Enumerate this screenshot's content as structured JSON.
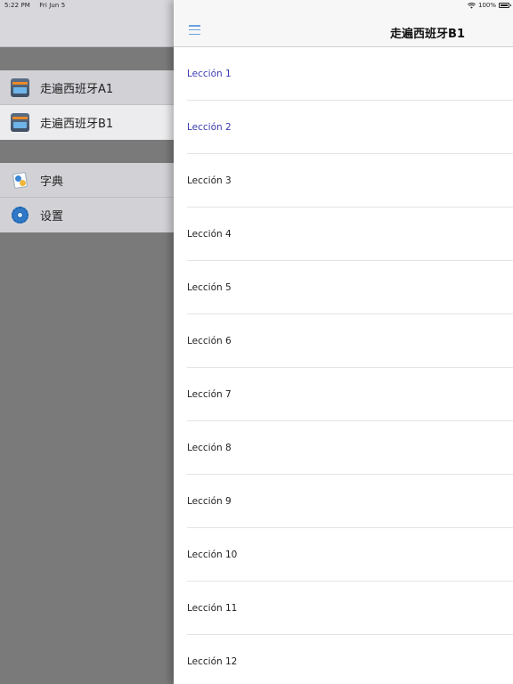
{
  "status_bar": {
    "time": "5:22 PM",
    "date": "Fri Jun 5",
    "battery_text": "100%",
    "icons": [
      "wifi-icon",
      "battery-icon"
    ]
  },
  "sidebar": {
    "books": [
      {
        "label": "走遍西班牙A1",
        "icon": "book-icon",
        "selected": false
      },
      {
        "label": "走遍西班牙B1",
        "icon": "book-icon",
        "selected": true
      }
    ],
    "tools": [
      {
        "label": "字典",
        "icon": "dictionary-icon"
      },
      {
        "label": "设置",
        "icon": "gear-icon"
      }
    ]
  },
  "main": {
    "title": "走遍西班牙B1",
    "menu_icon": "hamburger-menu-icon",
    "lessons": [
      {
        "label": "Lección 1",
        "visited": true
      },
      {
        "label": "Lección 2",
        "visited": true
      },
      {
        "label": "Lección 3",
        "visited": false
      },
      {
        "label": "Lección 4",
        "visited": false
      },
      {
        "label": "Lección 5",
        "visited": false
      },
      {
        "label": "Lección 6",
        "visited": false
      },
      {
        "label": "Lección 7",
        "visited": false
      },
      {
        "label": "Lección 8",
        "visited": false
      },
      {
        "label": "Lección 9",
        "visited": false
      },
      {
        "label": "Lección 10",
        "visited": false
      },
      {
        "label": "Lección 11",
        "visited": false
      },
      {
        "label": "Lección 12",
        "visited": false
      }
    ]
  },
  "colors": {
    "accent": "#6aa3e0",
    "visited_link": "#3b3bb0",
    "dim_background": "#7a7a7a"
  }
}
